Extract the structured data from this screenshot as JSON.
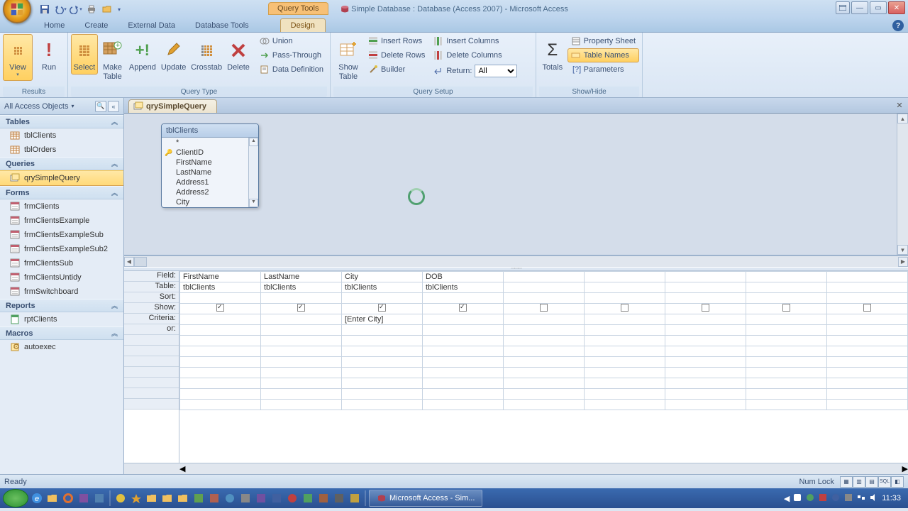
{
  "title": {
    "context": "Query Tools",
    "text": "Simple Database : Database (Access 2007) - Microsoft Access"
  },
  "tabs": [
    "Home",
    "Create",
    "External Data",
    "Database Tools"
  ],
  "tab_design": "Design",
  "ribbon": {
    "results": {
      "view": "View",
      "run": "Run",
      "label": "Results"
    },
    "query_type": {
      "select": "Select",
      "make_table": "Make\nTable",
      "append": "Append",
      "update": "Update",
      "crosstab": "Crosstab",
      "delete": "Delete",
      "union": "Union",
      "passthrough": "Pass-Through",
      "datadef": "Data Definition",
      "label": "Query Type"
    },
    "setup": {
      "show_table": "Show\nTable",
      "insert_rows": "Insert Rows",
      "delete_rows": "Delete Rows",
      "builder": "Builder",
      "insert_cols": "Insert Columns",
      "delete_cols": "Delete Columns",
      "return": "Return:",
      "return_val": "All",
      "label": "Query Setup"
    },
    "totals": {
      "totals": "Totals",
      "prop_sheet": "Property Sheet",
      "table_names": "Table Names",
      "parameters": "Parameters",
      "label": "Show/Hide"
    }
  },
  "nav": {
    "header": "All Access Objects",
    "sections": {
      "tables": {
        "label": "Tables",
        "items": [
          "tblClients",
          "tblOrders"
        ]
      },
      "queries": {
        "label": "Queries",
        "items": [
          "qrySimpleQuery"
        ]
      },
      "forms": {
        "label": "Forms",
        "items": [
          "frmClients",
          "frmClientsExample",
          "frmClientsExampleSub",
          "frmClientsExampleSub2",
          "frmClientsSub",
          "frmClientsUntidy",
          "frmSwitchboard"
        ]
      },
      "reports": {
        "label": "Reports",
        "items": [
          "rptClients"
        ]
      },
      "macros": {
        "label": "Macros",
        "items": [
          "autoexec"
        ]
      }
    }
  },
  "doc_tab": "qrySimpleQuery",
  "table_window": {
    "title": "tblClients",
    "fields": [
      "*",
      "ClientID",
      "FirstName",
      "LastName",
      "Address1",
      "Address2",
      "City"
    ]
  },
  "design_grid": {
    "row_labels": [
      "Field:",
      "Table:",
      "Sort:",
      "Show:",
      "Criteria:",
      "or:"
    ],
    "columns": [
      {
        "field": "FirstName",
        "table": "tblClients",
        "show": true,
        "criteria": ""
      },
      {
        "field": "LastName",
        "table": "tblClients",
        "show": true,
        "criteria": ""
      },
      {
        "field": "City",
        "table": "tblClients",
        "show": true,
        "criteria": "[Enter City]"
      },
      {
        "field": "DOB",
        "table": "tblClients",
        "show": true,
        "criteria": ""
      }
    ]
  },
  "status": {
    "ready": "Ready",
    "numlock": "Num Lock"
  },
  "taskbar": {
    "task": "Microsoft Access - Sim...",
    "time": "11:33"
  }
}
